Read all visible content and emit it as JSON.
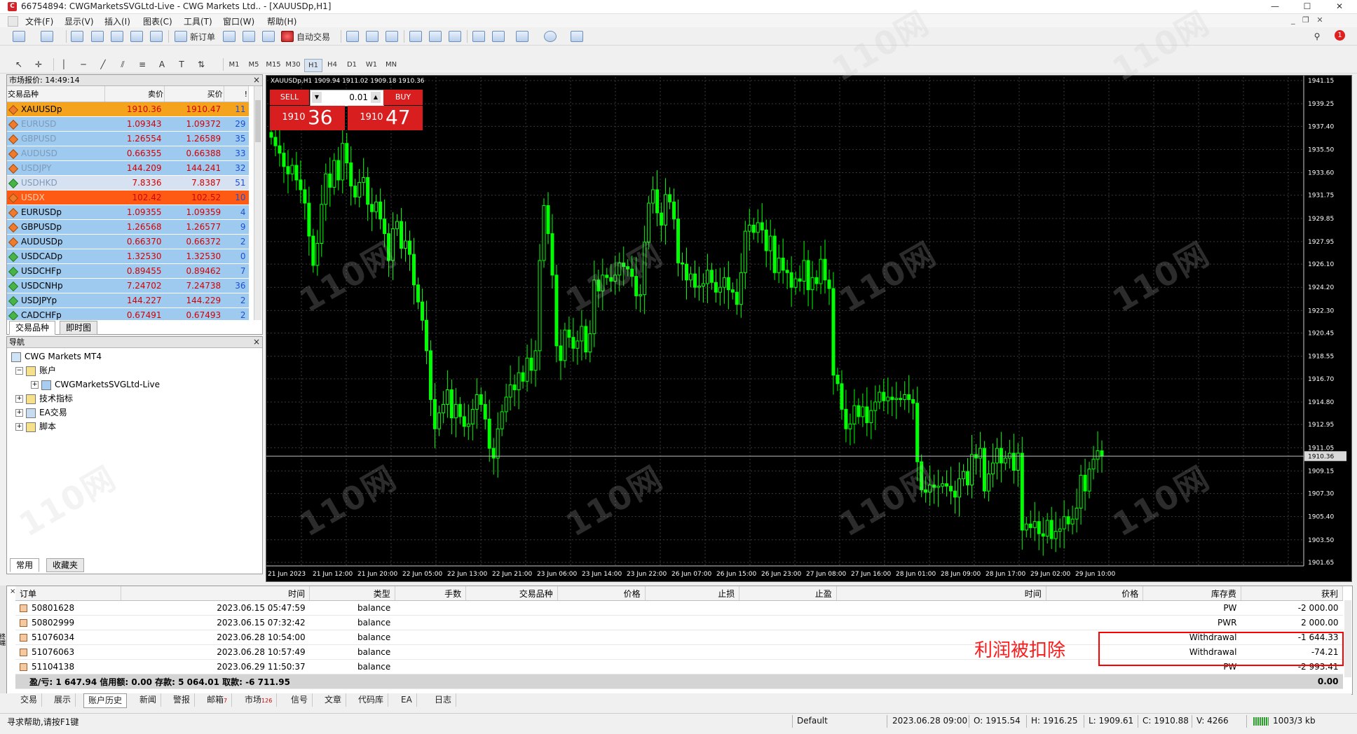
{
  "window": {
    "title": "66754894: CWGMarketsSVGLtd-Live - CWG Markets Ltd.. - [XAUUSDp,H1]",
    "minimize": "—",
    "maximize": "☐",
    "close": "✕"
  },
  "menu": [
    "文件(F)",
    "显示(V)",
    "插入(I)",
    "图表(C)",
    "工具(T)",
    "窗口(W)",
    "帮助(H)"
  ],
  "toolbar": {
    "new_order": "新订单",
    "auto_trade": "自动交易",
    "timeframes": [
      "M1",
      "M5",
      "M15",
      "M30",
      "H1",
      "H4",
      "D1",
      "W1",
      "MN"
    ],
    "active_timeframe": "H1",
    "text_tool": "A"
  },
  "market_watch": {
    "header": "市场报价: 14:49:14",
    "columns": [
      "交易品种",
      "卖价",
      "买价",
      "!"
    ],
    "rows": [
      {
        "symbol": "XAUUSDp",
        "bid": "1910.36",
        "ask": "1910.47",
        "spread": "11",
        "style": "orange"
      },
      {
        "symbol": "EURUSD",
        "bid": "1.09343",
        "ask": "1.09372",
        "spread": "29",
        "style": "blue"
      },
      {
        "symbol": "GBPUSD",
        "bid": "1.26554",
        "ask": "1.26589",
        "spread": "35",
        "style": "blue"
      },
      {
        "symbol": "AUDUSD",
        "bid": "0.66355",
        "ask": "0.66388",
        "spread": "33",
        "style": "blue"
      },
      {
        "symbol": "USDJPY",
        "bid": "144.209",
        "ask": "144.241",
        "spread": "32",
        "style": "blue"
      },
      {
        "symbol": "USDHKD",
        "bid": "7.8336",
        "ask": "7.8387",
        "spread": "51",
        "style": "lavender"
      },
      {
        "symbol": "USDX",
        "bid": "102.42",
        "ask": "102.52",
        "spread": "10",
        "style": "red"
      },
      {
        "symbol": "EURUSDp",
        "bid": "1.09355",
        "ask": "1.09359",
        "spread": "4",
        "style": "blue"
      },
      {
        "symbol": "GBPUSDp",
        "bid": "1.26568",
        "ask": "1.26577",
        "spread": "9",
        "style": "blue"
      },
      {
        "symbol": "AUDUSDp",
        "bid": "0.66370",
        "ask": "0.66372",
        "spread": "2",
        "style": "blue"
      },
      {
        "symbol": "USDCADp",
        "bid": "1.32530",
        "ask": "1.32530",
        "spread": "0",
        "style": "blue"
      },
      {
        "symbol": "USDCHFp",
        "bid": "0.89455",
        "ask": "0.89462",
        "spread": "7",
        "style": "blue"
      },
      {
        "symbol": "USDCNHp",
        "bid": "7.24702",
        "ask": "7.24738",
        "spread": "36",
        "style": "blue"
      },
      {
        "symbol": "USDJPYp",
        "bid": "144.227",
        "ask": "144.229",
        "spread": "2",
        "style": "blue"
      },
      {
        "symbol": "CADCHFp",
        "bid": "0.67491",
        "ask": "0.67493",
        "spread": "2",
        "style": "blue"
      }
    ],
    "tabs": [
      "交易品种",
      "即时图"
    ]
  },
  "navigator": {
    "header": "导航",
    "root": "CWG Markets MT4",
    "accounts": "账户",
    "account_name": "CWGMarketsSVGLtd-Live",
    "indicators": "技术指标",
    "experts": "EA交易",
    "scripts": "脚本",
    "tabs": [
      "常用",
      "收藏夹"
    ]
  },
  "chart": {
    "header": "XAUUSDp,H1  1909.94 1911.02 1909.18 1910.36",
    "sell_label": "SELL",
    "buy_label": "BUY",
    "lot": "0.01",
    "sell_price_small": "1910",
    "sell_price_big": "36",
    "buy_price_small": "1910",
    "buy_price_big": "47",
    "current_price": "1910.36",
    "price_labels": [
      "1941.15",
      "1939.25",
      "1937.40",
      "1935.50",
      "1933.60",
      "1931.75",
      "1929.85",
      "1927.95",
      "1926.10",
      "1924.20",
      "1922.30",
      "1920.45",
      "1918.55",
      "1916.70",
      "1914.80",
      "1912.95",
      "1911.05",
      "1909.15",
      "1907.30",
      "1905.40",
      "1903.50",
      "1901.65"
    ],
    "time_labels": [
      "21 Jun 2023",
      "21 Jun 12:00",
      "21 Jun 20:00",
      "22 Jun 05:00",
      "22 Jun 13:00",
      "22 Jun 21:00",
      "23 Jun 06:00",
      "23 Jun 14:00",
      "23 Jun 22:00",
      "26 Jun 07:00",
      "26 Jun 15:00",
      "26 Jun 23:00",
      "27 Jun 08:00",
      "27 Jun 16:00",
      "28 Jun 01:00",
      "28 Jun 09:00",
      "28 Jun 17:00",
      "29 Jun 02:00",
      "29 Jun 10:00"
    ],
    "y_range": [
      1901.65,
      1941.15
    ],
    "candle_color": "#00ff00",
    "grid_color": "#3a3a3a",
    "background": "#000000"
  },
  "chart_data": {
    "type": "candlestick",
    "title": "XAUUSDp,H1",
    "ylim": [
      1901.65,
      1941.15
    ],
    "closes": [
      1936.5,
      1935.8,
      1935.2,
      1934.1,
      1933.5,
      1934.2,
      1933.0,
      1932.2,
      1931.1,
      1928.4,
      1926.0,
      1927.8,
      1931.0,
      1933.5,
      1932.4,
      1934.6,
      1933.0,
      1936.0,
      1934.4,
      1932.5,
      1931.6,
      1932.8,
      1933.2,
      1931.0,
      1930.4,
      1931.2,
      1929.8,
      1928.6,
      1926.4,
      1929.0,
      1929.6,
      1927.4,
      1928.0,
      1926.9,
      1924.4,
      1923.0,
      1921.5,
      1919.0,
      1915.0,
      1912.6,
      1913.9,
      1914.6,
      1915.8,
      1913.5,
      1914.6,
      1913.6,
      1912.8,
      1913.0,
      1914.2,
      1915.4,
      1914.6,
      1913.4,
      1911.0,
      1910.2,
      1912.6,
      1914.0,
      1915.2,
      1916.2,
      1915.8,
      1917.2,
      1916.5,
      1918.4,
      1917.4,
      1919.0,
      1926.4,
      1930.9,
      1928.6,
      1925.2,
      1919.4,
      1918.2,
      1920.7,
      1920.1,
      1919.2,
      1919.8,
      1921.0,
      1918.9,
      1920.4,
      1924.8,
      1923.9,
      1925.2,
      1925.0,
      1924.7,
      1925.2,
      1926.2,
      1925.9,
      1925.7,
      1925.1,
      1923.5,
      1923.6,
      1927.9,
      1931.1,
      1932.2,
      1930.3,
      1929.3,
      1931.8,
      1931.2,
      1929.8,
      1926.2,
      1926.1,
      1924.8,
      1925.3,
      1924.2,
      1924.3,
      1924.5,
      1925.6,
      1924.6,
      1923.8,
      1924.2,
      1925.0,
      1924.0,
      1923.8,
      1922.8,
      1925.4,
      1928.8,
      1929.3,
      1928.7,
      1929.5,
      1928.9,
      1927.2,
      1928.4,
      1925.4,
      1926.6,
      1925.6,
      1925.4,
      1924.2,
      1924.9,
      1924.7,
      1926.4,
      1924.0,
      1925.0,
      1924.5,
      1926.5,
      1924.8,
      1924.1,
      1917.0,
      1916.3,
      1914.2,
      1912.6,
      1913.0,
      1914.5,
      1913.6,
      1914.4,
      1913.1,
      1914.1,
      1914.8,
      1915.6,
      1914.9,
      1915.2,
      1915.0,
      1915.1,
      1915.0,
      1915.4,
      1915.0,
      1914.7,
      1909.9,
      1907.6,
      1907.4,
      1908.0,
      1907.8,
      1907.9,
      1908.1,
      1907.9,
      1907.5,
      1907.0,
      1908.5,
      1909.1,
      1908.0,
      1910.5,
      1910.2,
      1911.0,
      1907.5,
      1908.9,
      1909.8,
      1911.0,
      1909.8,
      1910.2,
      1910.6,
      1909.2,
      1910.6,
      1904.3,
      1904.8,
      1904.5,
      1905.0,
      1904.0,
      1903.8,
      1905.1,
      1903.6,
      1904.2,
      1904.4,
      1905.4,
      1904.8,
      1905.2,
      1906.1,
      1908.8,
      1907.5,
      1909.3,
      1910.1,
      1910.8,
      1910.36
    ]
  },
  "terminal": {
    "columns": [
      "订单",
      "时间",
      "类型",
      "手数",
      "交易品种",
      "价格",
      "止损",
      "止盈",
      "时间",
      "价格",
      "库存费",
      "获利"
    ],
    "rows": [
      {
        "order": "50801628",
        "time": "2023.06.15 05:47:59",
        "type": "balance",
        "comment": "PW",
        "profit": "-2 000.00"
      },
      {
        "order": "50802999",
        "time": "2023.06.15 07:32:42",
        "type": "balance",
        "comment": "PWR",
        "profit": "2 000.00"
      },
      {
        "order": "51076034",
        "time": "2023.06.28 10:54:00",
        "type": "balance",
        "comment": "Withdrawal",
        "profit": "-1 644.33"
      },
      {
        "order": "51076063",
        "time": "2023.06.28 10:57:49",
        "type": "balance",
        "comment": "Withdrawal",
        "profit": "-74.21"
      },
      {
        "order": "51104138",
        "time": "2023.06.29 11:50:37",
        "type": "balance",
        "comment": "PW",
        "profit": "-2 993.41"
      }
    ],
    "summary": "盈/亏: 1 647.94  信用额: 0.00  存款: 5 064.01  取款: -6 711.95",
    "summary_total": "0.00",
    "annotation": "利润被扣除",
    "tabs": [
      {
        "label": "交易",
        "badge": ""
      },
      {
        "label": "展示",
        "badge": ""
      },
      {
        "label": "账户历史",
        "badge": ""
      },
      {
        "label": "新闻",
        "badge": ""
      },
      {
        "label": "警报",
        "badge": ""
      },
      {
        "label": "邮箱",
        "badge": "7"
      },
      {
        "label": "市场",
        "badge": "126"
      },
      {
        "label": "信号",
        "badge": ""
      },
      {
        "label": "文章",
        "badge": ""
      },
      {
        "label": "代码库",
        "badge": ""
      },
      {
        "label": "EA",
        "badge": ""
      },
      {
        "label": "日志",
        "badge": ""
      }
    ],
    "active_tab": "账户历史",
    "side_label": "终端"
  },
  "status": {
    "help": "寻求帮助,请按F1键",
    "profile": "Default",
    "datetime": "2023.06.28 09:00",
    "open": "O: 1915.54",
    "high": "H: 1916.25",
    "low": "L: 1909.61",
    "close": "C: 1910.88",
    "volume": "V: 4266",
    "traffic": "1003/3 kb"
  },
  "watermark": "110网"
}
